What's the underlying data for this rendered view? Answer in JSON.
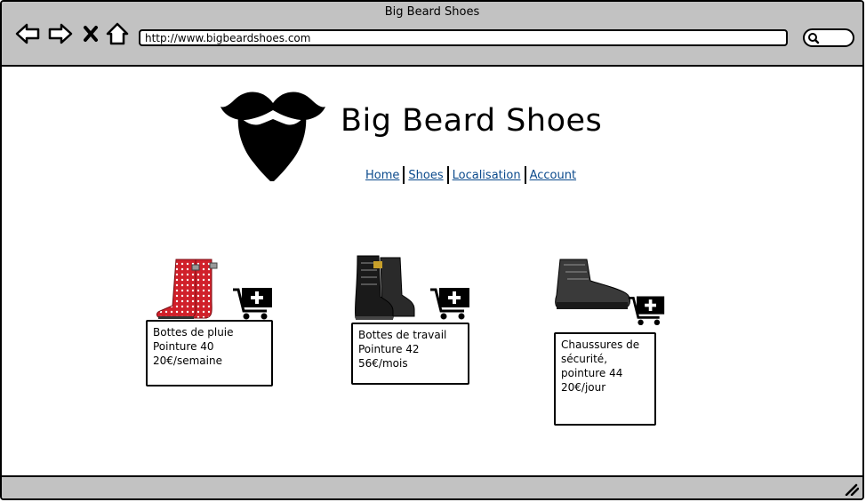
{
  "window": {
    "title": "Big Beard Shoes"
  },
  "address_bar": {
    "url": "http://www.bigbeardshoes.com"
  },
  "icons": {
    "back": "back-arrow-icon",
    "forward": "forward-arrow-icon",
    "stop": "close-icon",
    "home": "home-icon",
    "search": "search-icon",
    "logo": "beard-mustache-logo",
    "cart": "add-to-cart-icon",
    "resize": "resize-grip-icon"
  },
  "site": {
    "title": "Big Beard Shoes",
    "nav": [
      {
        "label": "Home"
      },
      {
        "label": "Shoes"
      },
      {
        "label": "Localisation"
      },
      {
        "label": "Account"
      }
    ]
  },
  "products": [
    {
      "name": "Bottes de pluie",
      "size": "Pointure 40",
      "price": "20€/semaine"
    },
    {
      "name": "Bottes de travail",
      "size": "Pointure 42",
      "price": "56€/mois"
    },
    {
      "name": "Chaussures de sécurité,",
      "size": "pointure 44",
      "price": "20€/jour"
    }
  ],
  "colors": {
    "chrome": "#c2c2c2",
    "link": "#0b4a8c",
    "boot_red": "#d0202a"
  }
}
